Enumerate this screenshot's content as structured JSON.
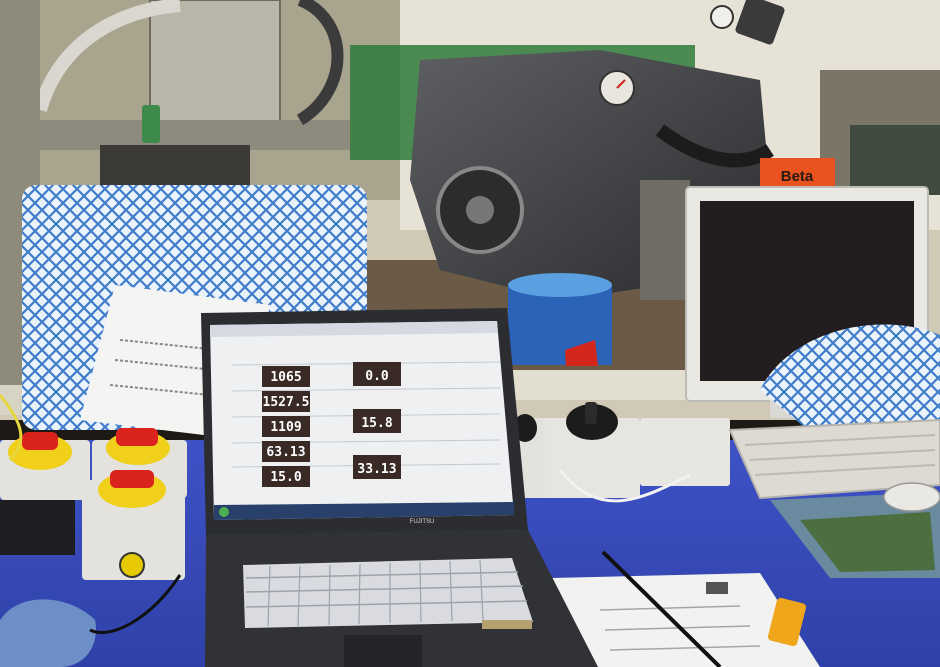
{
  "scene": {
    "colors": {
      "wall": "#d9d6c8",
      "desk": "#3a4fc4",
      "laptop_body": "#2b2d31",
      "screen_bg": "#eef0f2",
      "readout_bg": "#3a2a26",
      "switch_yellow": "#f0d01a",
      "switch_red": "#d9231c",
      "monitor_bezel": "#e9e8e3",
      "checked_cloth": "#5a8fd0",
      "beta_orange": "#e8531f"
    }
  },
  "signage": {
    "beta_label": "Beta"
  },
  "laptop": {
    "brand": "FUJITSU",
    "readouts_left": [
      "1065",
      "1527.5",
      "1109",
      "63.13",
      "15.0"
    ],
    "readouts_right": [
      "0.0",
      "15.8",
      "33.13"
    ]
  }
}
